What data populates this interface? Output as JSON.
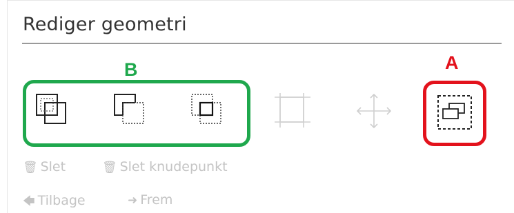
{
  "panel": {
    "title": "Rediger geometri"
  },
  "annotations": {
    "label_b": "B",
    "label_a": "A",
    "color_b": "#1fa84d",
    "color_a": "#e3121c"
  },
  "tools": [
    {
      "name": "union-tool",
      "icon": "union-overlap-icon",
      "enabled": true
    },
    {
      "name": "difference-tool",
      "icon": "difference-icon",
      "enabled": true
    },
    {
      "name": "intersect-tool",
      "icon": "intersect-icon",
      "enabled": true
    },
    {
      "name": "edit-vertices-tool",
      "icon": "edit-vertices-icon",
      "enabled": false
    },
    {
      "name": "move-tool",
      "icon": "move-arrows-icon",
      "enabled": false
    },
    {
      "name": "copy-geometry-tool",
      "icon": "copy-geometry-icon",
      "enabled": true
    }
  ],
  "actions": {
    "delete_label": "Slet",
    "delete_vertex_label": "Slet knudepunkt",
    "back_label": "Tilbage",
    "forward_label": "Frem",
    "disabled_color": "#c4c4c4"
  }
}
